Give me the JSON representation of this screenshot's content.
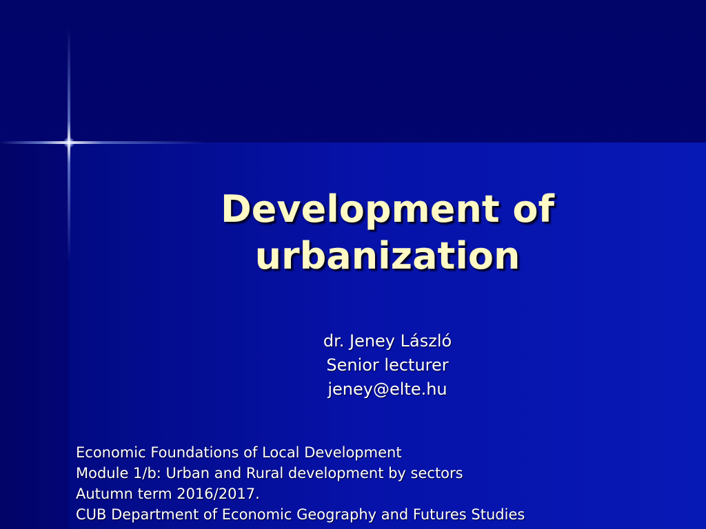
{
  "slide": {
    "title_lines": [
      "Development of",
      "urbanization"
    ],
    "author": {
      "name": "dr. Jeney László",
      "position": "Senior lecturer",
      "email": "jeney@elte.hu"
    },
    "footer_lines": [
      "Economic Foundations of Local Development",
      "Module 1/b: Urban and Rural development by sectors",
      "Autumn term 2016/2017.",
      "CUB Department of Economic Geography and Futures Studies"
    ]
  },
  "colors": {
    "background_dark": "#00035e",
    "background_blue": "#0719b5",
    "title_color": "#fff9c4",
    "text_color": "#ffffff"
  }
}
